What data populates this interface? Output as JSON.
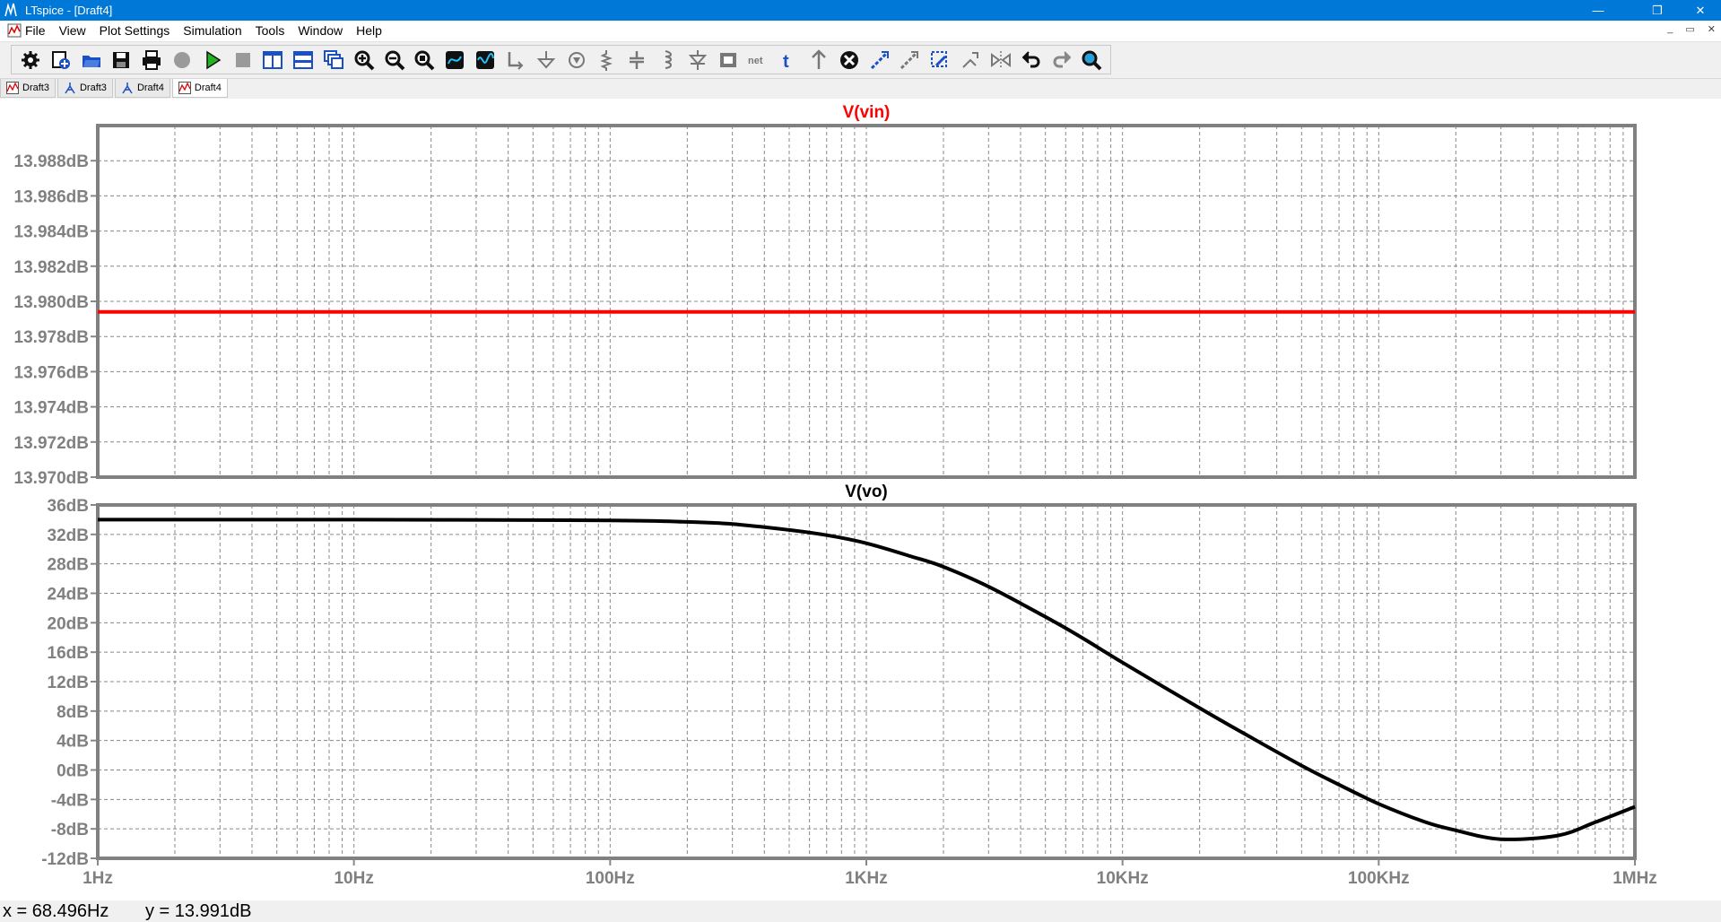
{
  "window": {
    "title": "LTspice - [Draft4]",
    "minimize": "—",
    "maximize": "❐",
    "close": "✕"
  },
  "menu": [
    "File",
    "View",
    "Plot Settings",
    "Simulation",
    "Tools",
    "Window",
    "Help"
  ],
  "mdi_controls": [
    "_",
    "▭",
    "✕"
  ],
  "toolbar": [
    "gear-icon",
    "new-schematic-icon",
    "open-icon",
    "save-icon",
    "print-icon",
    "halt-icon",
    "run-icon",
    "stop-icon",
    "tile-vertical-icon",
    "tile-horizontal-icon",
    "cascade-icon",
    "zoom-in-icon",
    "zoom-out-icon",
    "zoom-fit-icon",
    "autorange-icon",
    "waveform-icon",
    "wire-icon",
    "ground-icon",
    "label-net-icon",
    "resistor-icon",
    "capacitor-icon",
    "inductor-icon",
    "diode-icon",
    "component-icon",
    "spice-directive-icon",
    "text-icon",
    "move-icon",
    "delete-icon",
    "duplicate-icon",
    "drag-icon",
    "rotate-icon",
    "mirror-icon",
    "flip-icon",
    "undo-icon",
    "redo-icon",
    "find-icon"
  ],
  "tabs": [
    {
      "label": "Draft3",
      "icon": "waveform-tab-icon",
      "active": false
    },
    {
      "label": "Draft3",
      "icon": "schematic-tab-icon",
      "active": false
    },
    {
      "label": "Draft4",
      "icon": "schematic-tab-icon",
      "active": false
    },
    {
      "label": "Draft4",
      "icon": "waveform-tab-icon",
      "active": true
    }
  ],
  "status": {
    "x_text": "x = 68.496Hz",
    "y_text": "y = 13.991dB"
  },
  "chart_data": [
    {
      "type": "line",
      "title": "V(vin)",
      "title_color": "#ff0000",
      "xscale": "log",
      "xlim": [
        1,
        1000000
      ],
      "ylim": [
        13.97,
        13.99
      ],
      "yticks": [
        13.97,
        13.972,
        13.974,
        13.976,
        13.978,
        13.98,
        13.982,
        13.984,
        13.986,
        13.988
      ],
      "ytick_labels": [
        "13.970dB",
        "13.972dB",
        "13.974dB",
        "13.976dB",
        "13.978dB",
        "13.980dB",
        "13.982dB",
        "13.984dB",
        "13.986dB",
        "13.988dB"
      ],
      "grid": true,
      "series": [
        {
          "color": "#ff0000",
          "x": [
            1,
            1000000
          ],
          "y": [
            13.9794,
            13.9794
          ]
        }
      ]
    },
    {
      "type": "line",
      "title": "V(vo)",
      "title_color": "#000000",
      "xscale": "log",
      "xlim": [
        1,
        1000000
      ],
      "ylim": [
        -12,
        36
      ],
      "yticks": [
        -12,
        -8,
        -4,
        0,
        4,
        8,
        12,
        16,
        20,
        24,
        28,
        32,
        36
      ],
      "ytick_labels": [
        "-12dB",
        "-8dB",
        "-4dB",
        "0dB",
        "4dB",
        "8dB",
        "12dB",
        "16dB",
        "20dB",
        "24dB",
        "28dB",
        "32dB",
        "36dB"
      ],
      "xticks": [
        1,
        10,
        100,
        1000,
        10000,
        100000,
        1000000
      ],
      "xtick_labels": [
        "1Hz",
        "10Hz",
        "100Hz",
        "1KHz",
        "10KHz",
        "100KHz",
        "1MHz"
      ],
      "grid": true,
      "series": [
        {
          "color": "#000000",
          "x": [
            1,
            10,
            100,
            200,
            300,
            500,
            700,
            1000,
            1500,
            2000,
            3000,
            5000,
            7000,
            10000,
            20000,
            30000,
            50000,
            70000,
            100000,
            150000,
            200000,
            300000,
            500000,
            700000,
            1000000
          ],
          "y": [
            34.0,
            34.0,
            33.9,
            33.7,
            33.4,
            32.6,
            31.9,
            30.8,
            29.0,
            27.6,
            24.9,
            20.8,
            17.9,
            14.6,
            8.4,
            4.9,
            0.6,
            -2.0,
            -4.6,
            -7.0,
            -8.2,
            -9.4,
            -8.9,
            -7.1,
            -5.0
          ]
        }
      ]
    }
  ]
}
